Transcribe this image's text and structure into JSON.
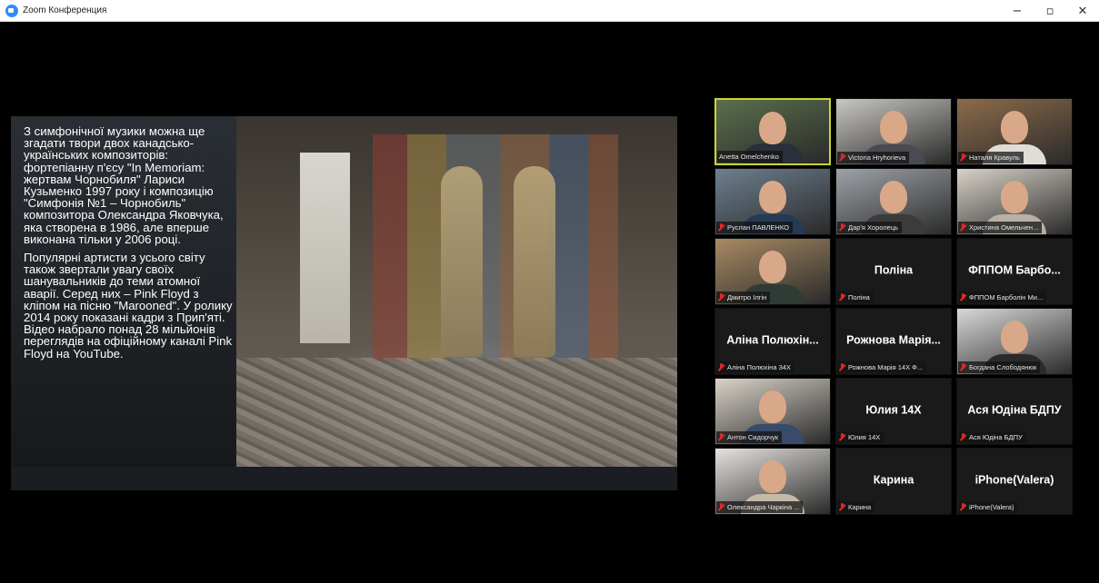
{
  "window": {
    "title": "Zoom Конференция",
    "minimize_glyph": "−",
    "maximize_glyph": "▫",
    "close_glyph": "✕"
  },
  "slide": {
    "paragraph_1": "З симфонічної музики можна ще згадати твори двох канадсько-українських композиторів: фортепіанну п'єсу \"In Memoriam: жертвам Чорнобиля\" Лариси Кузьменко 1997 року і композицію \"Симфонія №1 – Чорнобиль\" композитора Олександра Яковчука, яка створена в 1986, але вперше виконана тільки у 2006 році.",
    "paragraph_2": "Популярні артисти з усього світу також звертали увагу своїх шанувальників до теми атомної аварії. Серед них – Pink Floyd з кліпом на пісню \"Marooned\". У ролику 2014 року показані кадри з Прип'яті. Відео набрало понад 28 мільйонів переглядів на офіційному каналі Pink Floyd на YouTube."
  },
  "participants": [
    {
      "label": "Anetta Omelchenko",
      "name": "",
      "video": true,
      "muted": false,
      "active": true,
      "bg": "#5a6f4c",
      "shirt": "#2b2f3a"
    },
    {
      "label": "Victoria Hryhorieva",
      "name": "",
      "video": true,
      "muted": true,
      "active": false,
      "bg": "#c9c7c2",
      "shirt": "#4a4a52"
    },
    {
      "label": "Наталя Кравуль",
      "name": "",
      "video": true,
      "muted": true,
      "active": false,
      "bg": "#8c6b4a",
      "shirt": "#e0ddd6"
    },
    {
      "label": "Руслан ПАВЛЕНКО",
      "name": "",
      "video": true,
      "muted": true,
      "active": false,
      "bg": "#6d7f8e",
      "shirt": "#243a55"
    },
    {
      "label": "Дар'я Хоролець",
      "name": "",
      "video": true,
      "muted": true,
      "active": false,
      "bg": "#9ea3a8",
      "shirt": "#3b3b3b"
    },
    {
      "label": "Христина Омельчен...",
      "name": "",
      "video": true,
      "muted": true,
      "active": false,
      "bg": "#d7d2c8",
      "shirt": "#b9b0a5"
    },
    {
      "label": "Дмитро Ілгін",
      "name": "",
      "video": true,
      "muted": true,
      "active": false,
      "bg": "#a88a63",
      "shirt": "#2f3c35"
    },
    {
      "label": "Поліна",
      "name": "Поліна",
      "video": false,
      "muted": true,
      "active": false
    },
    {
      "label": "ФППОМ Барболін Ми...",
      "name": "ФППОМ Барбо...",
      "video": false,
      "muted": true,
      "active": false
    },
    {
      "label": "Аліна Полюхіна 34Х",
      "name": "Аліна Полюхін...",
      "video": false,
      "muted": true,
      "active": false
    },
    {
      "label": "Рожнова Марія 14Х Ф...",
      "name": "Рожнова Марія...",
      "video": false,
      "muted": true,
      "active": false
    },
    {
      "label": "Богдана Слободянюк",
      "name": "",
      "video": true,
      "muted": true,
      "active": false,
      "bg": "#d8d8d8",
      "shirt": "#2b2b2b"
    },
    {
      "label": "Антон Сидорчук",
      "name": "",
      "video": true,
      "muted": true,
      "active": false,
      "bg": "#d9d3c8",
      "shirt": "#3a4a6a"
    },
    {
      "label": "Юлия 14Х",
      "name": "Юлия 14Х",
      "video": false,
      "muted": true,
      "active": false
    },
    {
      "label": "Ася Юдіна БДПУ",
      "name": "Ася Юдіна БДПУ",
      "video": false,
      "muted": true,
      "active": false
    },
    {
      "label": "Олександра Чаркіна ...",
      "name": "",
      "video": true,
      "muted": true,
      "active": false,
      "bg": "#e6e3de",
      "shirt": "#c6b9a8"
    },
    {
      "label": "Карина",
      "name": "Карина",
      "video": false,
      "muted": true,
      "active": false
    },
    {
      "label": "iPhone(Valera)",
      "name": "iPhone(Valera)",
      "video": false,
      "muted": true,
      "active": false
    }
  ]
}
